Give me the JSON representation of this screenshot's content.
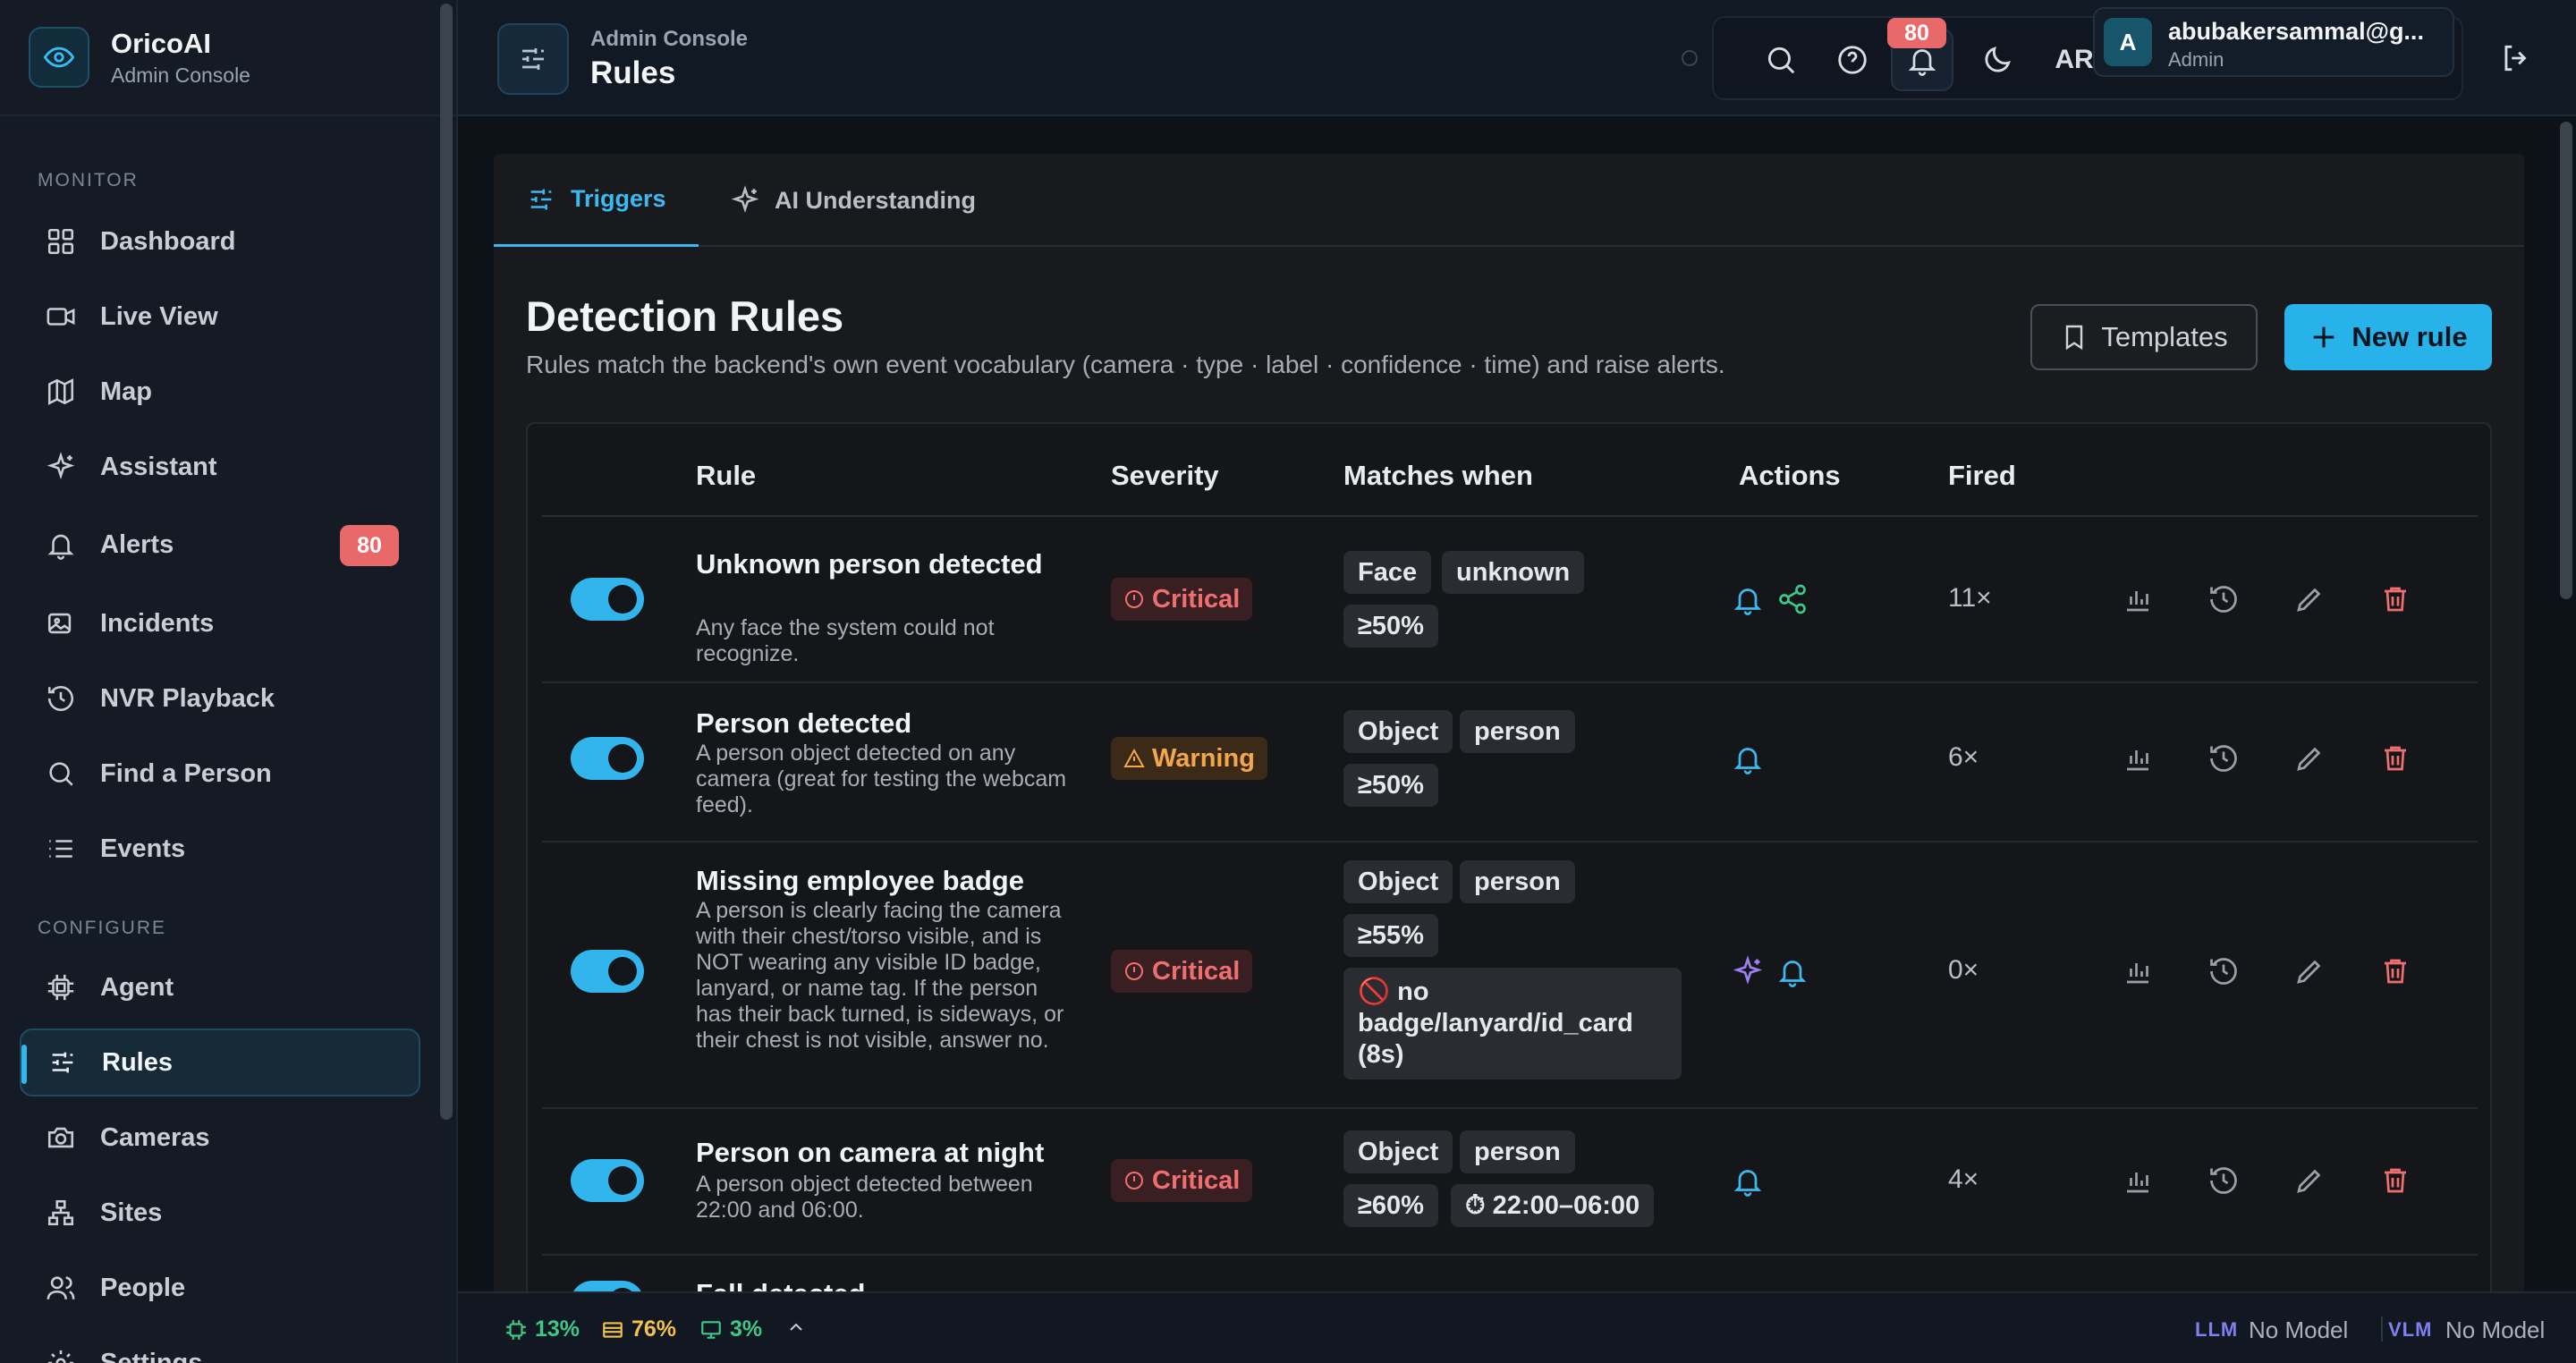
{
  "brand": {
    "name": "OricoAI",
    "subtitle": "Admin Console"
  },
  "sidebar": {
    "monitor_label": "MONITOR",
    "configure_label": "CONFIGURE",
    "monitor_items": [
      {
        "label": "Dashboard",
        "icon": "grid-icon"
      },
      {
        "label": "Live View",
        "icon": "video-icon"
      },
      {
        "label": "Map",
        "icon": "map-icon"
      },
      {
        "label": "Assistant",
        "icon": "sparkle-icon"
      },
      {
        "label": "Alerts",
        "icon": "bell-icon",
        "badge": "80"
      },
      {
        "label": "Incidents",
        "icon": "image-icon"
      },
      {
        "label": "NVR Playback",
        "icon": "history-icon"
      },
      {
        "label": "Find a Person",
        "icon": "search-icon"
      },
      {
        "label": "Events",
        "icon": "list-icon"
      }
    ],
    "configure_items": [
      {
        "label": "Agent",
        "icon": "chip-icon"
      },
      {
        "label": "Rules",
        "icon": "sliders-icon",
        "active": true
      },
      {
        "label": "Cameras",
        "icon": "camera-icon"
      },
      {
        "label": "Sites",
        "icon": "network-icon"
      },
      {
        "label": "People",
        "icon": "users-icon"
      },
      {
        "label": "Settings",
        "icon": "gear-icon"
      }
    ]
  },
  "topbar": {
    "breadcrumb": "Admin Console",
    "title": "Rules",
    "notification_count": "80",
    "language": "AR",
    "user_email": "abubakersammal@g...",
    "user_role": "Admin",
    "avatar_initial": "A"
  },
  "tabs": [
    {
      "label": "Triggers",
      "active": true
    },
    {
      "label": "AI Understanding",
      "active": false
    }
  ],
  "page": {
    "title": "Detection Rules",
    "subtitle": "Rules match the backend's own event vocabulary (camera · type · label · confidence · time) and raise alerts.",
    "templates_label": "Templates",
    "new_rule_label": "New rule"
  },
  "table": {
    "headers": [
      "Rule",
      "Severity",
      "Matches when",
      "Actions",
      "Fired"
    ],
    "rows": [
      {
        "name": "Unknown person detected",
        "description": "Any face the system could not recognize.",
        "enabled": true,
        "severity": "Critical",
        "chips": [
          "Face",
          "unknown",
          "≥50%"
        ],
        "actions": [
          "bell-icon",
          "share-icon"
        ],
        "fired": "11×"
      },
      {
        "name": "Person detected",
        "description": "A person object detected on any camera (great for testing the webcam feed).",
        "enabled": true,
        "severity": "Warning",
        "chips": [
          "Object",
          "person",
          "≥50%"
        ],
        "actions": [
          "bell-icon"
        ],
        "fired": "6×"
      },
      {
        "name": "Missing employee badge",
        "description": "A person is clearly facing the camera with their chest/torso visible, and is NOT wearing any visible ID badge, lanyard, or name tag. If the person has their back turned, is sideways, or their chest is not visible, answer no.",
        "enabled": true,
        "severity": "Critical",
        "chips": [
          "Object",
          "person",
          "≥55%",
          "🚫 no badge/lanyard/id_card (8s)"
        ],
        "actions": [
          "sparkle-icon",
          "bell-icon"
        ],
        "fired": "0×"
      },
      {
        "name": "Person on camera at night",
        "description": "A person object detected between 22:00 and 06:00.",
        "enabled": true,
        "severity": "Critical",
        "chips": [
          "Object",
          "person",
          "≥60%",
          "⏱ 22:00–06:00"
        ],
        "actions": [
          "bell-icon"
        ],
        "fired": "4×"
      },
      {
        "name": "Fall detected",
        "enabled": true
      }
    ]
  },
  "statusbar": {
    "cpu": "13%",
    "memory": "76%",
    "gpu": "3%",
    "llm_label": "LLM",
    "llm_value": "No Model",
    "vlm_label": "VLM",
    "vlm_value": "No Model"
  },
  "colors": {
    "accent": "#27b3ea",
    "critical": "#ef6f70",
    "warning": "#f4a64b",
    "badge": "#e9696a",
    "cpu": "#3ec98a",
    "memory": "#f2c14e",
    "gpu": "#3ec98a"
  }
}
